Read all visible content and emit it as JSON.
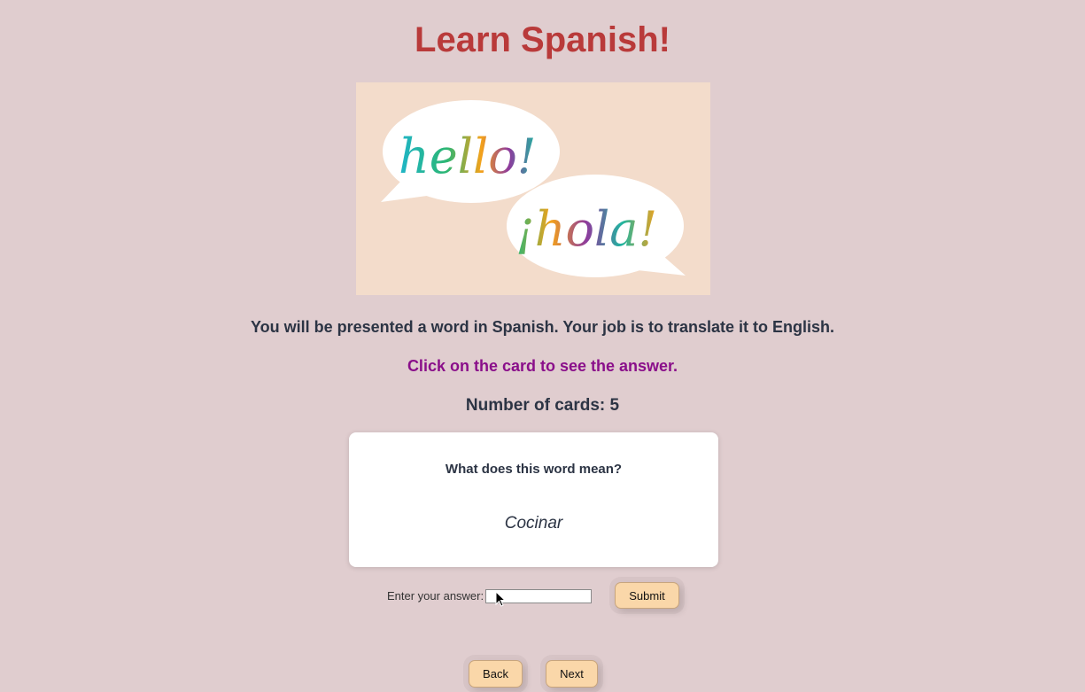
{
  "header": {
    "title": "Learn Spanish!"
  },
  "hero": {
    "english_word": "hello!",
    "spanish_word": "¡hola!"
  },
  "intro": {
    "instructions": "You will be presented a word in Spanish. Your job is to translate it to English.",
    "hint": "Click on the card to see the answer.",
    "count_text": "Number of cards: 5"
  },
  "card": {
    "question": "What does this word mean?",
    "word": "Cocinar"
  },
  "answer": {
    "label": "Enter your answer:",
    "value": "",
    "submit_label": "Submit"
  },
  "nav": {
    "back_label": "Back",
    "next_label": "Next"
  },
  "colors": {
    "background": "#e0cdcf",
    "title": "#b93a3a",
    "hint": "#8a0f8a",
    "button": "#fad7a9"
  }
}
